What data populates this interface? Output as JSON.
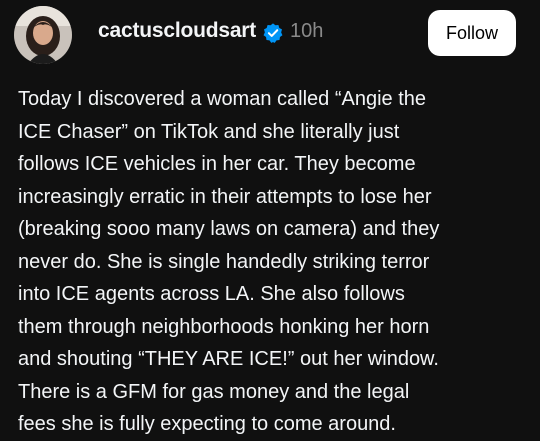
{
  "post": {
    "username": "cactuscloudsart",
    "verified_icon": "verified-badge-icon",
    "timestamp": "10h",
    "follow_label": "Follow",
    "body_lines": [
      "Today I discovered a woman called “Angie the",
      "ICE Chaser” on TikTok and she literally just",
      "follows ICE vehicles in her car. They become",
      "increasingly erratic in their attempts to lose her",
      "(breaking sooo many laws on camera) and they",
      "never do. She is single handedly striking terror",
      "into ICE agents across LA. She also follows",
      "them through neighborhoods honking her horn",
      "and shouting “THEY ARE ICE!” out her window.",
      "There is a GFM for gas money and the legal",
      "fees she is fully expecting to come around."
    ]
  },
  "colors": {
    "background": "#101010",
    "text": "#f3f5f7",
    "muted": "#8a8a8a",
    "verified": "#0095f6",
    "button_bg": "#ffffff",
    "button_text": "#000000"
  }
}
